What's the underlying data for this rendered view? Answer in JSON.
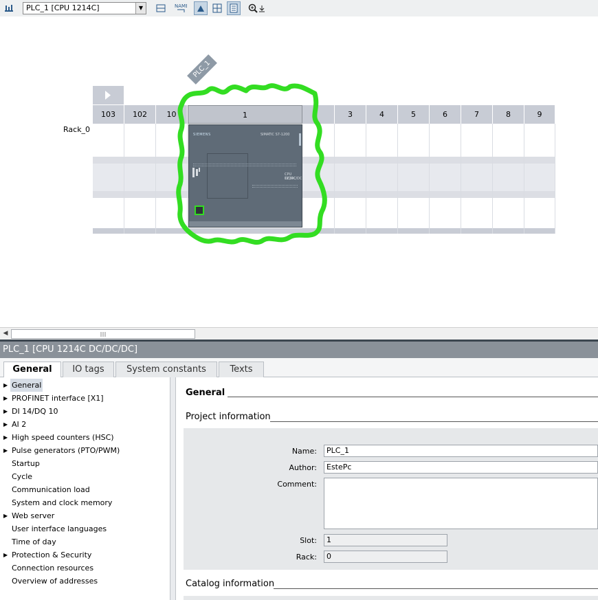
{
  "toolbar": {
    "device_select_value": "PLC_1 [CPU 1214C]"
  },
  "canvas": {
    "plc_tag": "PLC_1",
    "rack_label": "Rack_0",
    "slots": [
      "103",
      "102",
      "10",
      "1",
      "",
      "3",
      "4",
      "5",
      "6",
      "7",
      "8",
      "9"
    ],
    "module": {
      "brand": "SIEMENS",
      "series": "SIMATIC S7-1200",
      "model_line1": "CPU 1214C",
      "model_line2": "DC/DC/DC"
    }
  },
  "properties": {
    "title": "PLC_1 [CPU 1214C DC/DC/DC]",
    "tabs": [
      "General",
      "IO tags",
      "System constants",
      "Texts"
    ],
    "nav": [
      {
        "label": "General",
        "expand": true
      },
      {
        "label": "PROFINET interface [X1]",
        "expand": true
      },
      {
        "label": "DI 14/DQ 10",
        "expand": true
      },
      {
        "label": "AI 2",
        "expand": true
      },
      {
        "label": "High speed counters (HSC)",
        "expand": true
      },
      {
        "label": "Pulse generators (PTO/PWM)",
        "expand": true
      },
      {
        "label": "Startup",
        "expand": false
      },
      {
        "label": "Cycle",
        "expand": false
      },
      {
        "label": "Communication load",
        "expand": false
      },
      {
        "label": "System and clock memory",
        "expand": false
      },
      {
        "label": "Web server",
        "expand": true
      },
      {
        "label": "User interface languages",
        "expand": false
      },
      {
        "label": "Time of day",
        "expand": false
      },
      {
        "label": "Protection & Security",
        "expand": true
      },
      {
        "label": "Connection resources",
        "expand": false
      },
      {
        "label": "Overview of addresses",
        "expand": false
      }
    ],
    "general_heading": "General",
    "project_info_heading": "Project information",
    "catalog_info_heading": "Catalog information",
    "fields": {
      "name_label": "Name:",
      "name_value": "PLC_1",
      "author_label": "Author:",
      "author_value": "EstePc",
      "comment_label": "Comment:",
      "comment_value": "",
      "slot_label": "Slot:",
      "slot_value": "1",
      "rack_label": "Rack:",
      "rack_value": "0"
    }
  },
  "colors": {
    "highlight_outline": "#33dd22",
    "module_body": "#5f6b77",
    "slot_header": "#c8ccd5"
  }
}
